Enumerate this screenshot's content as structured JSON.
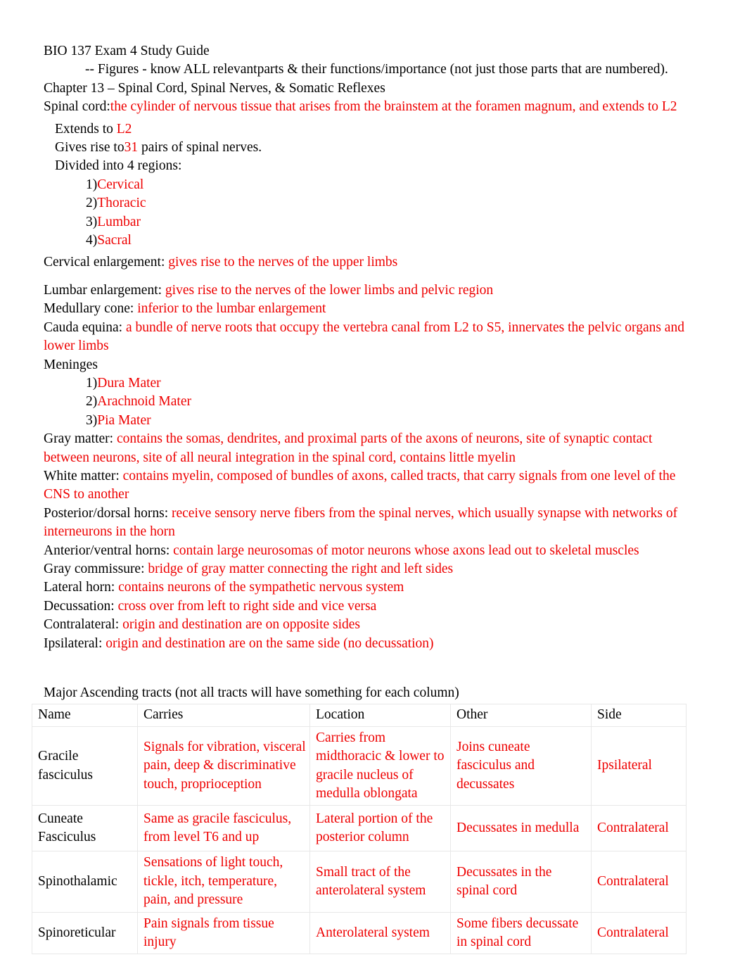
{
  "document": {
    "title": "BIO 137 Exam 4 Study Guide",
    "figures_note": "-- Figures - know ALL relevantparts & their functions/importance    (not just those parts that are numbered).",
    "chapter": "Chapter 13 – Spinal Cord, Spinal Nerves, & Somatic Reflexes",
    "accent_red": "#ee0000",
    "text_black": "#000000"
  },
  "entries": {
    "spinal_cord": {
      "label": "Spinal cord:",
      "answer": "the cylinder of nervous tissue that arises from the brainstem at the foramen magnum, and extends to L2"
    },
    "extends_to": {
      "label": "Extends to ",
      "answer": "L2"
    },
    "gives_rise": {
      "label_a": "Gives rise to",
      "answer": "31",
      "label_b": " pairs of spinal nerves."
    },
    "divided": {
      "label": "Divided into 4 regions:",
      "regions": [
        {
          "num": "1)",
          "name": "Cervical"
        },
        {
          "num": "2)",
          "name": "Thoracic"
        },
        {
          "num": "3)",
          "name": "Lumbar"
        },
        {
          "num": "4)",
          "name": "Sacral"
        }
      ]
    },
    "cervical_enlargement": {
      "label": "Cervical enlargement: ",
      "answer": "gives rise to the nerves of the upper limbs"
    },
    "lumbar_enlargement": {
      "label": "Lumbar enlargement: ",
      "answer": "gives rise to the nerves of the lower limbs and pelvic region"
    },
    "medullary_cone": {
      "label": "Medullary cone: ",
      "answer": "inferior to the lumbar enlargement"
    },
    "cauda_equina": {
      "label": "Cauda equina: ",
      "answer": "a bundle of nerve roots that occupy the vertebra canal from L2 to S5, innervates the pelvic organs and lower limbs"
    },
    "meninges": {
      "label": "Meninges",
      "layers": [
        {
          "num": "1)",
          "name": "Dura Mater"
        },
        {
          "num": "2)",
          "name": "Arachnoid Mater"
        },
        {
          "num": "3)",
          "name": "Pia Mater"
        }
      ]
    },
    "gray_matter": {
      "label": "Gray matter: ",
      "answer": "contains the somas, dendrites, and proximal parts of the axons of neurons, site of synaptic contact between neurons, site of all neural integration in the spinal cord, contains little myelin"
    },
    "white_matter": {
      "label": "White matter: ",
      "answer": "contains myelin, composed of bundles of axons, called tracts, that carry signals from one level of the CNS to another"
    },
    "posterior_horns": {
      "label": "Posterior/dorsal horns: ",
      "answer": "receive sensory nerve fibers from the spinal nerves, which usually synapse with networks of interneurons in the horn"
    },
    "anterior_horns": {
      "label": "Anterior/ventral horns: ",
      "answer": "contain large neurosomas of motor neurons whose axons lead out to skeletal muscles"
    },
    "gray_commissure": {
      "label": "Gray commissure: ",
      "answer": "bridge of gray matter connecting the right and left sides"
    },
    "lateral_horn": {
      "label": "Lateral horn: ",
      "answer": "contains neurons of the sympathetic nervous system"
    },
    "decussation": {
      "label": "Decussation: ",
      "answer": "cross over from left to right side and vice versa"
    },
    "contralateral": {
      "label": "Contralateral: ",
      "answer": "origin and destination are on opposite sides"
    },
    "ipsilateral": {
      "label": "Ipsilateral: ",
      "answer": "origin and destination are on the same side (no decussation)"
    }
  },
  "table": {
    "caption": "Major Ascending tracts (not all tracts will have something for each column)",
    "headers": [
      "Name",
      "Carries",
      "Location",
      "Other",
      "Side"
    ],
    "rows": [
      {
        "name": "Gracile fasciculus",
        "carries": "Signals for vibration, visceral pain, deep & discriminative touch, proprioception",
        "location": "Carries from midthoracic & lower to gracile nucleus of medulla oblongata",
        "other": "Joins cuneate fasciculus and decussates",
        "side": "Ipsilateral"
      },
      {
        "name": "Cuneate Fasciculus",
        "carries": "Same as gracile fasciculus, from level T6 and up",
        "location": "Lateral portion of the posterior column",
        "other": "Decussates in medulla",
        "side": "Contralateral"
      },
      {
        "name": "Spinothalamic",
        "carries": "Sensations of light touch, tickle, itch, temperature, pain, and pressure",
        "location": "Small tract of the anterolateral system",
        "other": "Decussates in the spinal cord",
        "side": "Contralateral"
      },
      {
        "name": "Spinoreticular",
        "carries": "Pain signals from tissue injury",
        "location": "Anterolateral system",
        "other": "Some fibers decussate in spinal cord",
        "side": "Contralateral"
      }
    ]
  }
}
